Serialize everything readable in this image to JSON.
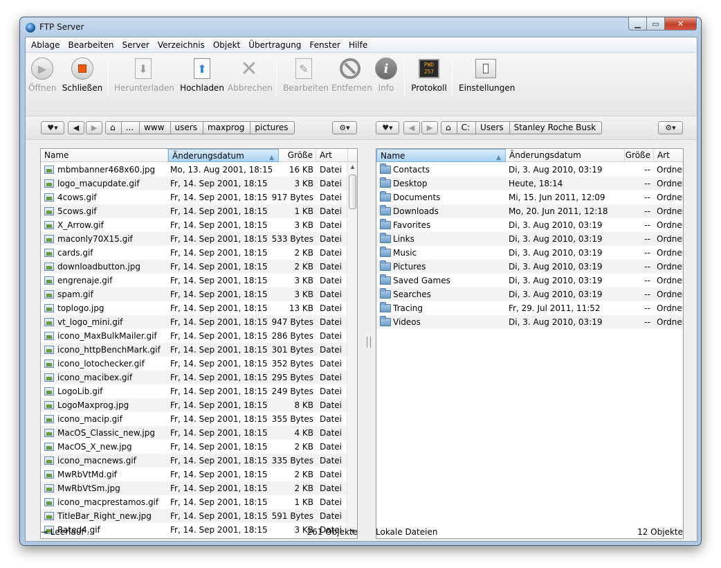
{
  "window": {
    "title": "FTP Server"
  },
  "menu": [
    "Ablage",
    "Bearbeiten",
    "Server",
    "Verzeichnis",
    "Objekt",
    "Übertragung",
    "Fenster",
    "Hilfe"
  ],
  "toolbar": {
    "open": "Öffnen",
    "close": "Schließen",
    "download": "Herunterladen",
    "upload": "Hochladen",
    "cancel": "Abbrechen",
    "edit": "Bearbeiten",
    "remove": "Entfernen",
    "info": "Info",
    "log": "Protokoll",
    "log_icon_text": "PWD 257",
    "settings": "Einstellungen"
  },
  "left_path": [
    "...",
    "www",
    "users",
    "maxprog",
    "pictures"
  ],
  "right_path": [
    "C:",
    "Users",
    "Stanley Roche Busk"
  ],
  "columns": {
    "name": "Name",
    "date": "Änderungsdatum",
    "size": "Größe",
    "kind": "Art"
  },
  "remote_files": [
    {
      "name": "mbmbanner468x60.jpg",
      "date": "Mo, 13. Aug 2001, 18:15",
      "size": "16 KB",
      "kind": "Datei"
    },
    {
      "name": "logo_macupdate.gif",
      "date": "Fr, 14. Sep 2001, 18:15",
      "size": "3 KB",
      "kind": "Datei"
    },
    {
      "name": "4cows.gif",
      "date": "Fr, 14. Sep 2001, 18:15",
      "size": "917 Bytes",
      "kind": "Datei"
    },
    {
      "name": "5cows.gif",
      "date": "Fr, 14. Sep 2001, 18:15",
      "size": "1 KB",
      "kind": "Datei"
    },
    {
      "name": "X_Arrow.gif",
      "date": "Fr, 14. Sep 2001, 18:15",
      "size": "3 KB",
      "kind": "Datei"
    },
    {
      "name": "maconly70X15.gif",
      "date": "Fr, 14. Sep 2001, 18:15",
      "size": "533 Bytes",
      "kind": "Datei"
    },
    {
      "name": "cards.gif",
      "date": "Fr, 14. Sep 2001, 18:15",
      "size": "2 KB",
      "kind": "Datei"
    },
    {
      "name": "downloadbutton.jpg",
      "date": "Fr, 14. Sep 2001, 18:15",
      "size": "2 KB",
      "kind": "Datei"
    },
    {
      "name": "engrenaje.gif",
      "date": "Fr, 14. Sep 2001, 18:15",
      "size": "3 KB",
      "kind": "Datei"
    },
    {
      "name": "spam.gif",
      "date": "Fr, 14. Sep 2001, 18:15",
      "size": "3 KB",
      "kind": "Datei"
    },
    {
      "name": "toplogo.jpg",
      "date": "Fr, 14. Sep 2001, 18:15",
      "size": "13 KB",
      "kind": "Datei"
    },
    {
      "name": "vt_logo_mini.gif",
      "date": "Fr, 14. Sep 2001, 18:15",
      "size": "947 Bytes",
      "kind": "Datei"
    },
    {
      "name": "icono_MaxBulkMailer.gif",
      "date": "Fr, 14. Sep 2001, 18:15",
      "size": "286 Bytes",
      "kind": "Datei"
    },
    {
      "name": "icono_httpBenchMark.gif",
      "date": "Fr, 14. Sep 2001, 18:15",
      "size": "301 Bytes",
      "kind": "Datei"
    },
    {
      "name": "icono_lotochecker.gif",
      "date": "Fr, 14. Sep 2001, 18:15",
      "size": "352 Bytes",
      "kind": "Datei"
    },
    {
      "name": "icono_macibex.gif",
      "date": "Fr, 14. Sep 2001, 18:15",
      "size": "295 Bytes",
      "kind": "Datei"
    },
    {
      "name": "LogoLib.gif",
      "date": "Fr, 14. Sep 2001, 18:15",
      "size": "249 Bytes",
      "kind": "Datei"
    },
    {
      "name": "LogoMaxprog.jpg",
      "date": "Fr, 14. Sep 2001, 18:15",
      "size": "8 KB",
      "kind": "Datei"
    },
    {
      "name": "icono_macip.gif",
      "date": "Fr, 14. Sep 2001, 18:15",
      "size": "355 Bytes",
      "kind": "Datei"
    },
    {
      "name": "MacOS_Classic_new.jpg",
      "date": "Fr, 14. Sep 2001, 18:15",
      "size": "4 KB",
      "kind": "Datei"
    },
    {
      "name": "MacOS_X_new.jpg",
      "date": "Fr, 14. Sep 2001, 18:15",
      "size": "2 KB",
      "kind": "Datei"
    },
    {
      "name": "icono_macnews.gif",
      "date": "Fr, 14. Sep 2001, 18:15",
      "size": "335 Bytes",
      "kind": "Datei"
    },
    {
      "name": "MwRbVtMd.gif",
      "date": "Fr, 14. Sep 2001, 18:15",
      "size": "2 KB",
      "kind": "Datei"
    },
    {
      "name": "MwRbVtSm.jpg",
      "date": "Fr, 14. Sep 2001, 18:15",
      "size": "2 KB",
      "kind": "Datei"
    },
    {
      "name": "icono_macprestamos.gif",
      "date": "Fr, 14. Sep 2001, 18:15",
      "size": "1 KB",
      "kind": "Datei"
    },
    {
      "name": "TitleBar_Right_new.jpg",
      "date": "Fr, 14. Sep 2001, 18:15",
      "size": "591 Bytes",
      "kind": "Datei"
    },
    {
      "name": "Rated4.gif",
      "date": "Fr, 14. Sep 2001, 18:15",
      "size": "3 KB",
      "kind": "Datei"
    }
  ],
  "local_files": [
    {
      "name": "Contacts",
      "date": "Di, 3. Aug 2010, 03:19",
      "size": "--",
      "kind": "Ordner"
    },
    {
      "name": "Desktop",
      "date": "Heute, 18:14",
      "size": "--",
      "kind": "Ordner"
    },
    {
      "name": "Documents",
      "date": "Mi, 15. Jun 2011, 12:09",
      "size": "--",
      "kind": "Ordner"
    },
    {
      "name": "Downloads",
      "date": "Mo, 20. Jun 2011, 12:18",
      "size": "--",
      "kind": "Ordner"
    },
    {
      "name": "Favorites",
      "date": "Di, 3. Aug 2010, 03:19",
      "size": "--",
      "kind": "Ordner"
    },
    {
      "name": "Links",
      "date": "Di, 3. Aug 2010, 03:19",
      "size": "--",
      "kind": "Ordner"
    },
    {
      "name": "Music",
      "date": "Di, 3. Aug 2010, 03:19",
      "size": "--",
      "kind": "Ordner"
    },
    {
      "name": "Pictures",
      "date": "Di, 3. Aug 2010, 03:19",
      "size": "--",
      "kind": "Ordner"
    },
    {
      "name": "Saved Games",
      "date": "Di, 3. Aug 2010, 03:19",
      "size": "--",
      "kind": "Ordner"
    },
    {
      "name": "Searches",
      "date": "Di, 3. Aug 2010, 03:19",
      "size": "--",
      "kind": "Ordner"
    },
    {
      "name": "Tracing",
      "date": "Fr, 29. Jul 2011, 11:52",
      "size": "--",
      "kind": "Ordner"
    },
    {
      "name": "Videos",
      "date": "Di, 3. Aug 2010, 03:19",
      "size": "--",
      "kind": "Ordner"
    }
  ],
  "status": {
    "left": "Leerlauf ...",
    "left_count": "261 Objekte",
    "right": "Lokale Dateien",
    "right_count": "12 Objekte"
  }
}
